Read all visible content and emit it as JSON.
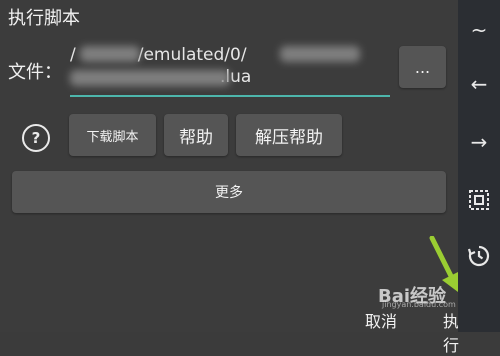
{
  "dialog": {
    "title": "执行脚本",
    "file_label": "文件：",
    "path_visible_start": "/",
    "path_visible_mid": "/emulated/0/",
    "path_visible_line2_end": ".lua",
    "browse_label": "...",
    "help_glyph": "?",
    "buttons": {
      "download": "下载脚本",
      "help": "帮助",
      "unzip_help": "解压帮助",
      "more": "更多"
    },
    "cancel": "取消",
    "execute": "执行"
  },
  "sidebar": {
    "icons": [
      "tilde-icon",
      "arrow-left-icon",
      "arrow-right-icon",
      "select-frame-icon",
      "history-icon"
    ],
    "glyphs": {
      "tilde": "~",
      "left": "←",
      "right": "→"
    }
  },
  "watermark": {
    "brand": "Bai经验",
    "url": "jingyan.baidu.com"
  },
  "colors": {
    "underline": "#4db6ac",
    "arrow": "#9acd32"
  }
}
